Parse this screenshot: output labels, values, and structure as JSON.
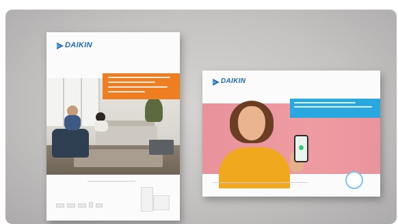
{
  "brochure_1": {
    "brand": "DAIKIN",
    "accent_color": "#ef7d22",
    "brand_color": "#1f68b4"
  },
  "brochure_2": {
    "brand": "DAIKIN",
    "accent_color": "#29a8e0",
    "brand_color": "#1f68b4"
  },
  "icons": [
    "daikin-logo-icon",
    "phone-icon",
    "certification-badge-icon"
  ]
}
